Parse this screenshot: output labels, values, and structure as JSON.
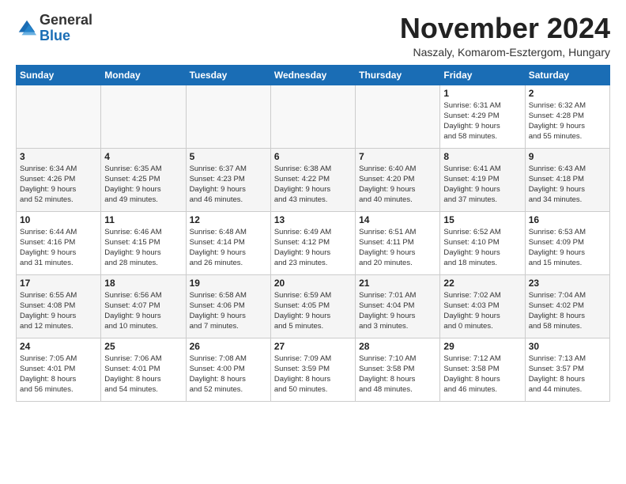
{
  "header": {
    "logo": {
      "general": "General",
      "blue": "Blue"
    },
    "title": "November 2024",
    "subtitle": "Naszaly, Komarom-Esztergom, Hungary"
  },
  "weekdays": [
    "Sunday",
    "Monday",
    "Tuesday",
    "Wednesday",
    "Thursday",
    "Friday",
    "Saturday"
  ],
  "weeks": [
    [
      {
        "day": "",
        "info": ""
      },
      {
        "day": "",
        "info": ""
      },
      {
        "day": "",
        "info": ""
      },
      {
        "day": "",
        "info": ""
      },
      {
        "day": "",
        "info": ""
      },
      {
        "day": "1",
        "info": "Sunrise: 6:31 AM\nSunset: 4:29 PM\nDaylight: 9 hours\nand 58 minutes."
      },
      {
        "day": "2",
        "info": "Sunrise: 6:32 AM\nSunset: 4:28 PM\nDaylight: 9 hours\nand 55 minutes."
      }
    ],
    [
      {
        "day": "3",
        "info": "Sunrise: 6:34 AM\nSunset: 4:26 PM\nDaylight: 9 hours\nand 52 minutes."
      },
      {
        "day": "4",
        "info": "Sunrise: 6:35 AM\nSunset: 4:25 PM\nDaylight: 9 hours\nand 49 minutes."
      },
      {
        "day": "5",
        "info": "Sunrise: 6:37 AM\nSunset: 4:23 PM\nDaylight: 9 hours\nand 46 minutes."
      },
      {
        "day": "6",
        "info": "Sunrise: 6:38 AM\nSunset: 4:22 PM\nDaylight: 9 hours\nand 43 minutes."
      },
      {
        "day": "7",
        "info": "Sunrise: 6:40 AM\nSunset: 4:20 PM\nDaylight: 9 hours\nand 40 minutes."
      },
      {
        "day": "8",
        "info": "Sunrise: 6:41 AM\nSunset: 4:19 PM\nDaylight: 9 hours\nand 37 minutes."
      },
      {
        "day": "9",
        "info": "Sunrise: 6:43 AM\nSunset: 4:18 PM\nDaylight: 9 hours\nand 34 minutes."
      }
    ],
    [
      {
        "day": "10",
        "info": "Sunrise: 6:44 AM\nSunset: 4:16 PM\nDaylight: 9 hours\nand 31 minutes."
      },
      {
        "day": "11",
        "info": "Sunrise: 6:46 AM\nSunset: 4:15 PM\nDaylight: 9 hours\nand 28 minutes."
      },
      {
        "day": "12",
        "info": "Sunrise: 6:48 AM\nSunset: 4:14 PM\nDaylight: 9 hours\nand 26 minutes."
      },
      {
        "day": "13",
        "info": "Sunrise: 6:49 AM\nSunset: 4:12 PM\nDaylight: 9 hours\nand 23 minutes."
      },
      {
        "day": "14",
        "info": "Sunrise: 6:51 AM\nSunset: 4:11 PM\nDaylight: 9 hours\nand 20 minutes."
      },
      {
        "day": "15",
        "info": "Sunrise: 6:52 AM\nSunset: 4:10 PM\nDaylight: 9 hours\nand 18 minutes."
      },
      {
        "day": "16",
        "info": "Sunrise: 6:53 AM\nSunset: 4:09 PM\nDaylight: 9 hours\nand 15 minutes."
      }
    ],
    [
      {
        "day": "17",
        "info": "Sunrise: 6:55 AM\nSunset: 4:08 PM\nDaylight: 9 hours\nand 12 minutes."
      },
      {
        "day": "18",
        "info": "Sunrise: 6:56 AM\nSunset: 4:07 PM\nDaylight: 9 hours\nand 10 minutes."
      },
      {
        "day": "19",
        "info": "Sunrise: 6:58 AM\nSunset: 4:06 PM\nDaylight: 9 hours\nand 7 minutes."
      },
      {
        "day": "20",
        "info": "Sunrise: 6:59 AM\nSunset: 4:05 PM\nDaylight: 9 hours\nand 5 minutes."
      },
      {
        "day": "21",
        "info": "Sunrise: 7:01 AM\nSunset: 4:04 PM\nDaylight: 9 hours\nand 3 minutes."
      },
      {
        "day": "22",
        "info": "Sunrise: 7:02 AM\nSunset: 4:03 PM\nDaylight: 9 hours\nand 0 minutes."
      },
      {
        "day": "23",
        "info": "Sunrise: 7:04 AM\nSunset: 4:02 PM\nDaylight: 8 hours\nand 58 minutes."
      }
    ],
    [
      {
        "day": "24",
        "info": "Sunrise: 7:05 AM\nSunset: 4:01 PM\nDaylight: 8 hours\nand 56 minutes."
      },
      {
        "day": "25",
        "info": "Sunrise: 7:06 AM\nSunset: 4:01 PM\nDaylight: 8 hours\nand 54 minutes."
      },
      {
        "day": "26",
        "info": "Sunrise: 7:08 AM\nSunset: 4:00 PM\nDaylight: 8 hours\nand 52 minutes."
      },
      {
        "day": "27",
        "info": "Sunrise: 7:09 AM\nSunset: 3:59 PM\nDaylight: 8 hours\nand 50 minutes."
      },
      {
        "day": "28",
        "info": "Sunrise: 7:10 AM\nSunset: 3:58 PM\nDaylight: 8 hours\nand 48 minutes."
      },
      {
        "day": "29",
        "info": "Sunrise: 7:12 AM\nSunset: 3:58 PM\nDaylight: 8 hours\nand 46 minutes."
      },
      {
        "day": "30",
        "info": "Sunrise: 7:13 AM\nSunset: 3:57 PM\nDaylight: 8 hours\nand 44 minutes."
      }
    ]
  ]
}
